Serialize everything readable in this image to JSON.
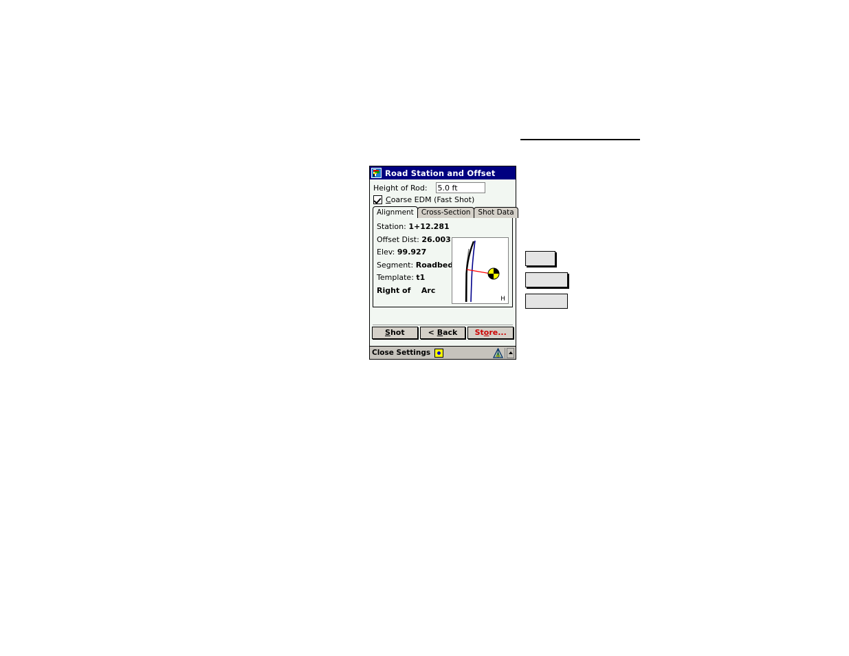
{
  "window": {
    "title": "Road Station and Offset",
    "title_icon": "map-flag-icon",
    "accent_color": "#000080"
  },
  "form": {
    "rod_label": "Height of Rod:",
    "rod_value": "5.0 ft",
    "rod_placeholder": "5.0 ft",
    "edm_checkbox_label_underlined": "C",
    "edm_checkbox_label_rest": "oarse EDM  (Fast Shot)",
    "edm_checked": true
  },
  "tabs": [
    {
      "label": "Alignment",
      "active": true
    },
    {
      "label": "Cross-Section",
      "active": false
    },
    {
      "label": "Shot Data",
      "active": false
    }
  ],
  "alignment": {
    "rows": [
      {
        "label": "Station:",
        "value": "1+12.281"
      },
      {
        "label": "Offset Dist:",
        "value": "26.003"
      },
      {
        "label": "Elev:",
        "value": "99.927"
      },
      {
        "label": "Segment:",
        "value": "Roadbed"
      },
      {
        "label": "Template:",
        "value": "t1"
      }
    ],
    "side_label": "Right of",
    "side_value": "Arc",
    "graphic": {
      "corner_label": "H",
      "target_icon": "prism-target-icon",
      "offset_line_color": "#ff0000",
      "alignment_line_color": "#000000",
      "template_line_color": "#00008b",
      "ground_line_color": "#808080"
    }
  },
  "buttons": {
    "shot": {
      "underlined": "S",
      "rest": "hot"
    },
    "back": {
      "prefix": "< ",
      "underlined": "B",
      "rest": "ack"
    },
    "store": {
      "pre": "St",
      "underlined": "o",
      "rest": "re..."
    }
  },
  "taskbar": {
    "text": "Close Settings",
    "sun_icon": "brightness-icon",
    "tri_icon": "survey-tripod-icon",
    "up_icon": "chevron-up-icon"
  },
  "side_boxes": [
    {
      "name": "blank-box-1"
    },
    {
      "name": "blank-box-2"
    },
    {
      "name": "blank-box-3"
    }
  ]
}
